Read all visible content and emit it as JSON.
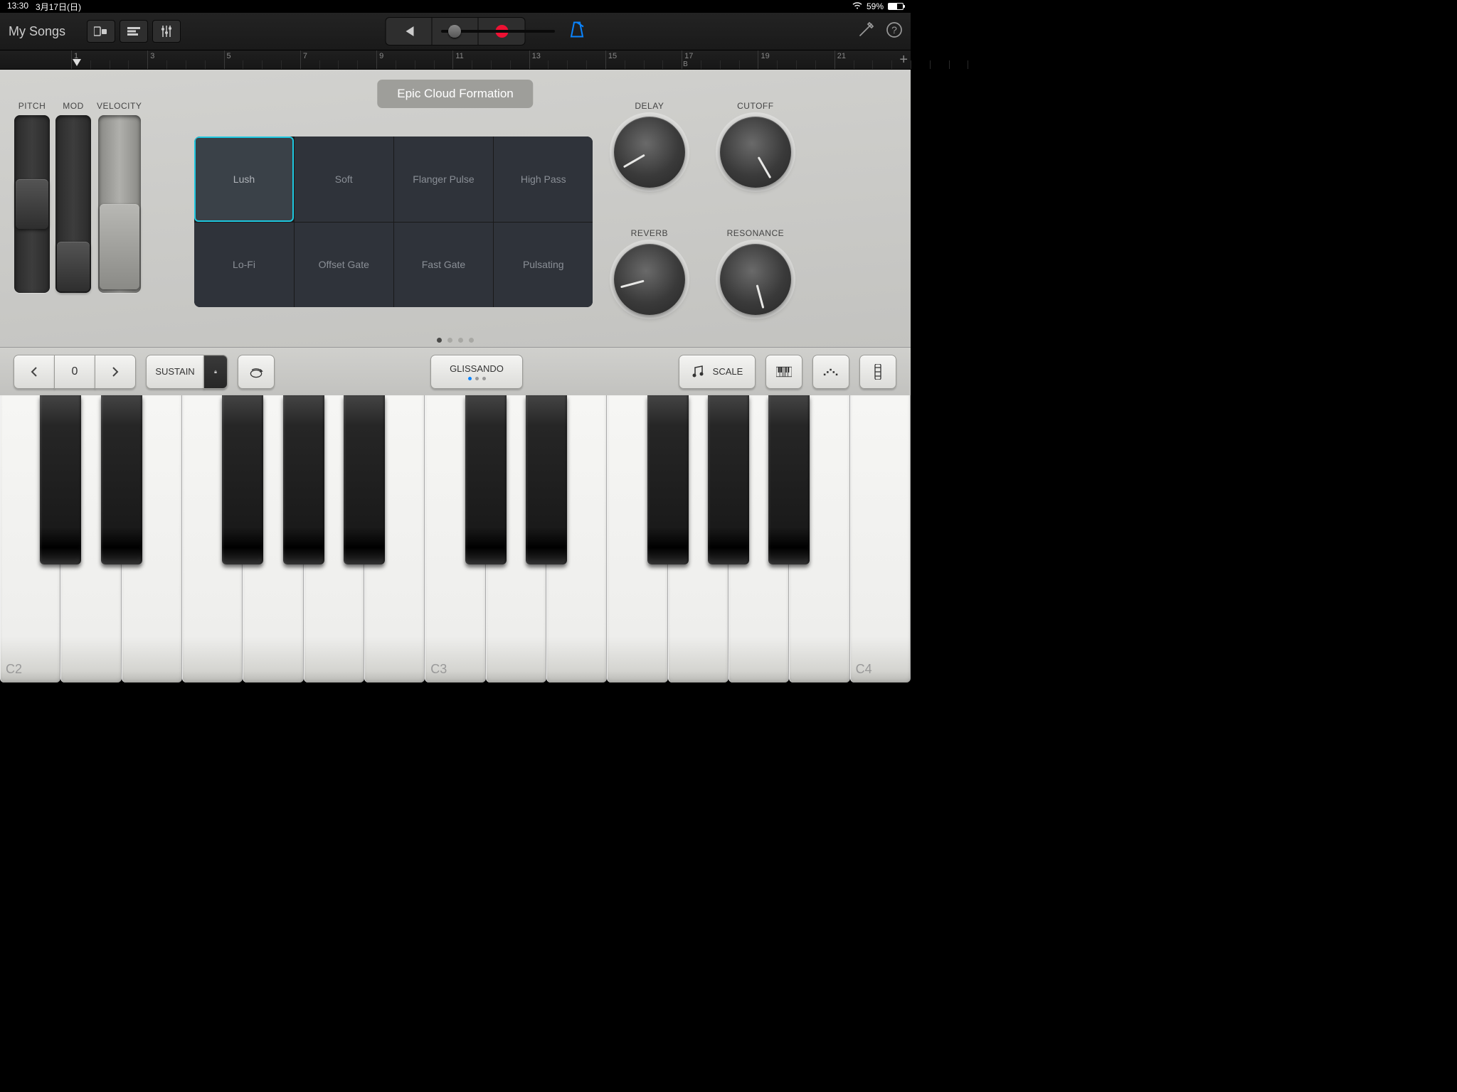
{
  "status": {
    "time": "13:30",
    "date": "3月17日(日)",
    "battery": "59%"
  },
  "toolbar": {
    "mySongs": "My Songs"
  },
  "ruler": {
    "bars": [
      "1",
      "3",
      "5",
      "7",
      "9",
      "11",
      "13",
      "15",
      "17",
      "19",
      "21"
    ],
    "sub": "B"
  },
  "preset": "Epic Cloud Formation",
  "sliders": [
    "PITCH",
    "MOD",
    "VELOCITY"
  ],
  "pads": [
    "Lush",
    "Soft",
    "Flanger Pulse",
    "High Pass",
    "Lo-Fi",
    "Offset Gate",
    "Fast Gate",
    "Pulsating"
  ],
  "selectedPad": 0,
  "knobs": [
    {
      "label": "DELAY",
      "angle": -120
    },
    {
      "label": "CUTOFF",
      "angle": 150
    },
    {
      "label": "REVERB",
      "angle": -105
    },
    {
      "label": "RESONANCE",
      "angle": 165
    }
  ],
  "kb": {
    "octave": "0",
    "sustain": "SUSTAIN",
    "gliss": "GLISSANDO",
    "scale": "SCALE"
  },
  "noteLabels": [
    "C2",
    "C3",
    "C4"
  ]
}
